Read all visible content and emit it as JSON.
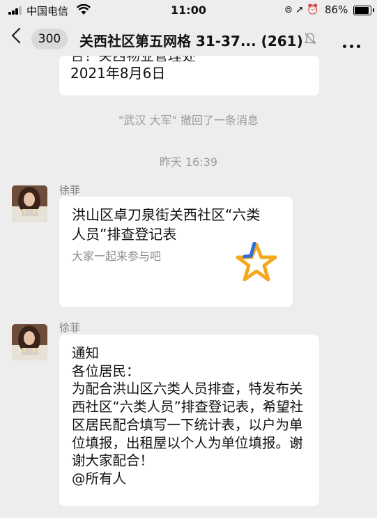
{
  "status_bar": {
    "carrier": "中国电信",
    "time": "11:00",
    "battery": "86%"
  },
  "navbar": {
    "unread_count": "300",
    "title": "关西社区第五网格 31-37... (261)",
    "icons": [
      "back-chevron-icon",
      "mute-bell-icon",
      "more-dots-icon"
    ]
  },
  "messages": {
    "prev_clipped": "合！关西物业管理处",
    "prev_date": "2021年8月6日",
    "recall_notice": "\"武汉 大军\" 撤回了一条消息",
    "timestamp": "昨天 16:39",
    "card": {
      "sender": "徐菲",
      "title": "洪山区卓刀泉街关西社区“六类人员”排查登记表",
      "desc": "大家一起来参与吧",
      "icon": "star-logo-icon",
      "star_color": "#f4a81d",
      "star_accent": "#2f6fd6"
    },
    "notice": {
      "sender": "徐菲",
      "text": "通知\n各位居民：\n为配合洪山区六类人员排查，特发布关西社区“六类人员”排查登记表，希望社区居民配合填写一下统计表，以户为单位填报，出租屋以个人为单位填报。谢谢大家配合！\n@所有人"
    }
  },
  "colors": {
    "background": "#ededed",
    "bubble": "#ffffff",
    "system_text": "#9b9b9b"
  }
}
